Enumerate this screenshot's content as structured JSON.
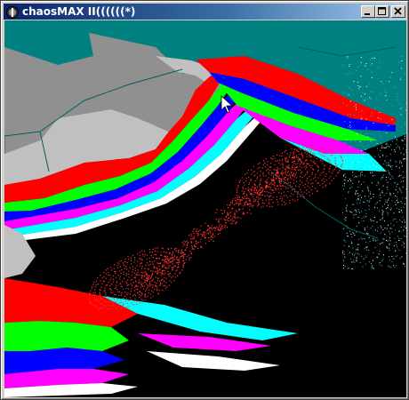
{
  "window": {
    "title": "chaosMAX II((((((*)",
    "icons": {
      "app": "chaosmax-app-icon",
      "minimize": "minimize-icon",
      "maximize": "maximize-icon",
      "close": "close-icon"
    }
  },
  "colors": {
    "titlebar_start": "#0a246a",
    "titlebar_end": "#a6caf0",
    "background": "#008080",
    "gray": "#909090",
    "silver": "#c0c0c0",
    "red": "#ff0000",
    "green": "#00ff00",
    "blue": "#0000ff",
    "magenta": "#ff00ff",
    "cyan": "#00ffff",
    "white": "#ffffff",
    "black": "#000000",
    "attractor": "#ff3030"
  }
}
